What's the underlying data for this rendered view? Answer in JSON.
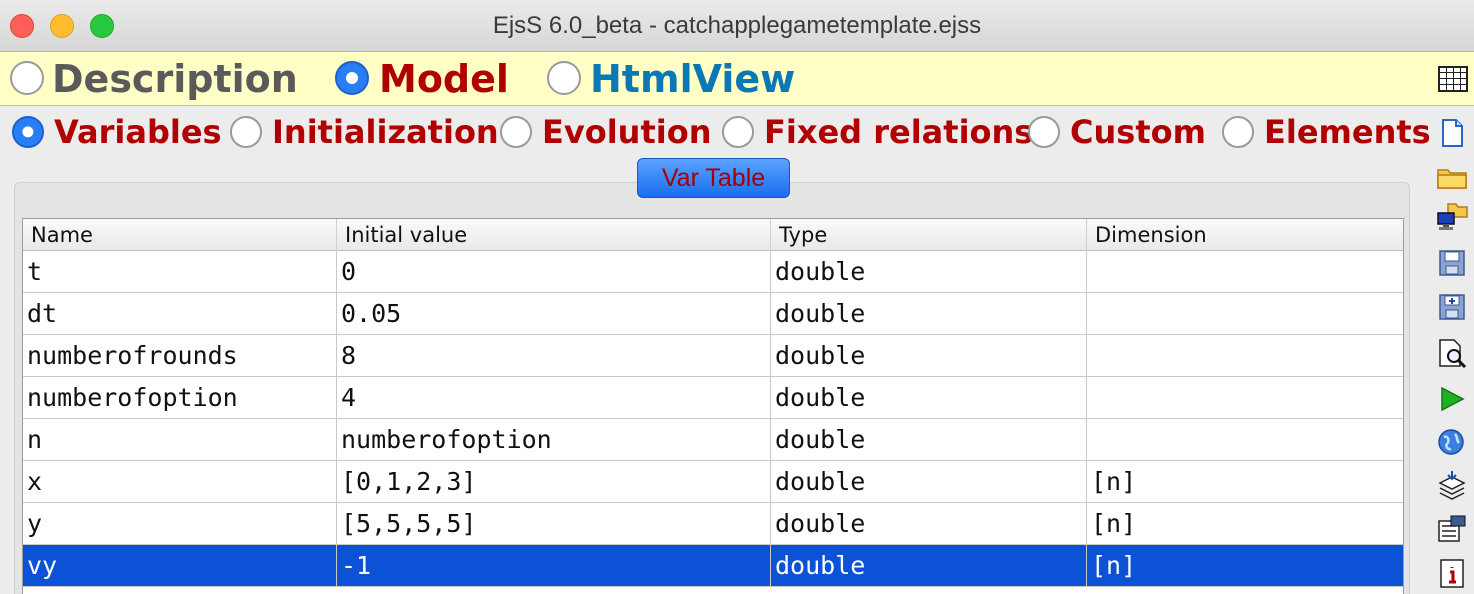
{
  "window": {
    "title": "EjsS 6.0_beta - catchapplegametemplate.ejss"
  },
  "top_tabs": [
    {
      "label": "Description",
      "color": "#5a5a5a",
      "selected": false
    },
    {
      "label": "Model",
      "color": "#b00000",
      "selected": true
    },
    {
      "label": "HtmlView",
      "color": "#0a78b4",
      "selected": false
    }
  ],
  "sub_tabs": [
    {
      "label": "Variables",
      "selected": true
    },
    {
      "label": "Initialization",
      "selected": false
    },
    {
      "label": "Evolution",
      "selected": false
    },
    {
      "label": "Fixed relations",
      "selected": false
    },
    {
      "label": "Custom",
      "selected": false
    },
    {
      "label": "Elements",
      "selected": false
    }
  ],
  "var_table_button": "Var Table",
  "table": {
    "headers": [
      "Name",
      "Initial value",
      "Type",
      "Dimension"
    ],
    "rows": [
      [
        "t",
        "0",
        "double",
        ""
      ],
      [
        "dt",
        "0.05",
        "double",
        ""
      ],
      [
        "numberofrounds",
        "8",
        "double",
        ""
      ],
      [
        "numberofoption",
        "4",
        "double",
        ""
      ],
      [
        "n",
        "numberofoption",
        "double",
        ""
      ],
      [
        "x",
        "[0,1,2,3]",
        "double",
        "[n]"
      ],
      [
        "y",
        "[5,5,5,5]",
        "double",
        "[n]"
      ],
      [
        "vy",
        "-1",
        "double",
        "[n]"
      ]
    ],
    "selected_row": 7
  },
  "toolbar_icons": [
    "table-icon",
    "new-file-icon",
    "open-folder-icon",
    "open-network-icon",
    "save-icon",
    "save-as-icon",
    "search-icon",
    "run-icon",
    "web-icon",
    "package-icon",
    "options-icon",
    "info-icon"
  ]
}
